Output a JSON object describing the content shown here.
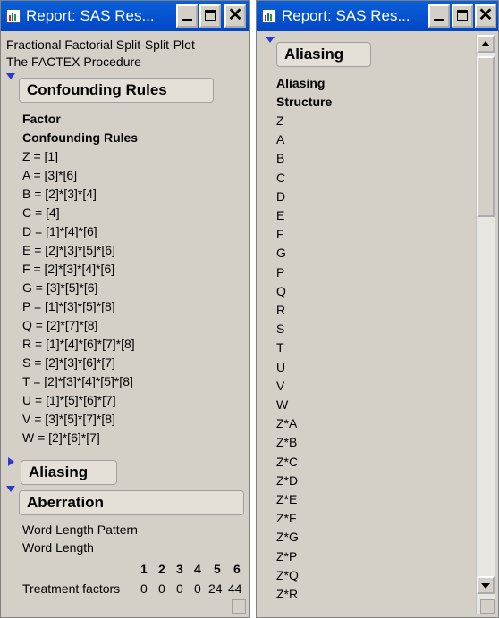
{
  "left_window": {
    "title": "Report: SAS Res...",
    "heading1": "Fractional Factorial Split-Split-Plot",
    "heading2": "The FACTEX Procedure",
    "sections": {
      "confounding": {
        "label": "Confounding Rules",
        "state": "expanded"
      },
      "aliasing": {
        "label": "Aliasing",
        "state": "collapsed"
      },
      "aberration": {
        "label": "Aberration",
        "state": "expanded"
      }
    },
    "confounding_table": {
      "header_line1": "Factor",
      "header_line2": "Confounding Rules",
      "rows": [
        "Z = [1]",
        "A = [3]*[6]",
        "B = [2]*[3]*[4]",
        "C = [4]",
        "D = [1]*[4]*[6]",
        "E = [2]*[3]*[5]*[6]",
        "F = [2]*[3]*[4]*[6]",
        "G = [3]*[5]*[6]",
        "P = [1]*[3]*[5]*[8]",
        "Q = [2]*[7]*[8]",
        "R = [1]*[4]*[6]*[7]*[8]",
        "S = [2]*[3]*[6]*[7]",
        "T = [2]*[3]*[4]*[5]*[8]",
        "U = [1]*[5]*[6]*[7]",
        "V = [3]*[5]*[7]*[8]",
        "W = [2]*[6]*[7]"
      ]
    },
    "aberration_table": {
      "title_line1": "Word Length Pattern",
      "title_line2": "Word Length",
      "columns": [
        "1",
        "2",
        "3",
        "4",
        "5",
        "6"
      ],
      "row_label": "Treatment factors",
      "values": [
        "0",
        "0",
        "0",
        "0",
        "24",
        "44"
      ]
    }
  },
  "right_window": {
    "title": "Report: SAS Res...",
    "section_label": "Aliasing",
    "header_line1": "Aliasing",
    "header_line2": "Structure",
    "rows": [
      "Z",
      "A",
      "B",
      "C",
      "D",
      "E",
      "F",
      "G",
      "P",
      "Q",
      "R",
      "S",
      "T",
      "U",
      "V",
      "W",
      "Z*A",
      "Z*B",
      "Z*C",
      "Z*D",
      "Z*E",
      "Z*F",
      "Z*G",
      "Z*P",
      "Z*Q",
      "Z*R"
    ]
  },
  "colors": {
    "titlebar": "#0046c8",
    "window_bg": "#d4d0c8",
    "disclosure_triangle": "#2a3ad0"
  },
  "icons": {
    "title": "sas-report-icon",
    "minimize": "minimize-icon",
    "maximize": "maximize-icon",
    "close": "close-icon"
  }
}
